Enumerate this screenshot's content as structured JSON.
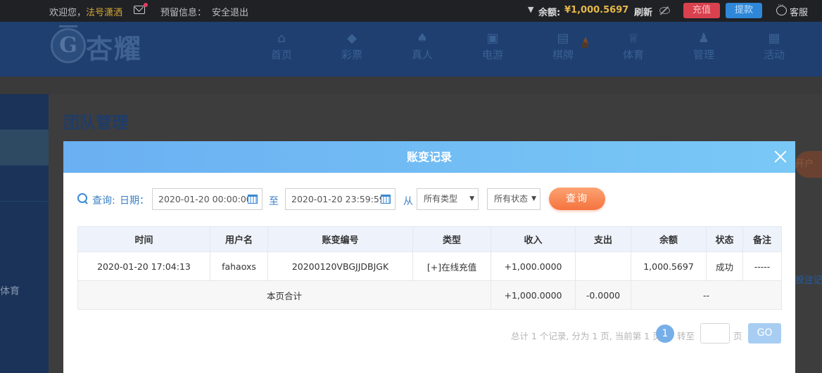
{
  "topbar": {
    "welcome": "欢迎您，",
    "username": "法号潇洒",
    "reserved_info_label": "预留信息：",
    "logout": "安全退出",
    "balance_label": "余额:",
    "balance_value": "¥1,000.5697",
    "refresh": "刷新",
    "recharge": "充值",
    "withdraw": "提款",
    "service": "客服"
  },
  "nav": {
    "logo_text": "杏耀",
    "logo_mark": "G",
    "items": [
      {
        "label": "首页",
        "icon": "home-icon",
        "glyph": "⌂"
      },
      {
        "label": "彩票",
        "icon": "lottery-icon",
        "glyph": "◆"
      },
      {
        "label": "真人",
        "icon": "live-dealer-icon",
        "glyph": "♠"
      },
      {
        "label": "电游",
        "icon": "slot-game-icon",
        "glyph": "▣"
      },
      {
        "label": "棋牌",
        "icon": "card-game-icon",
        "glyph": "▤"
      },
      {
        "label": "体育",
        "icon": "trophy-icon",
        "glyph": "♕"
      },
      {
        "label": "管理",
        "icon": "users-icon",
        "glyph": "♟"
      },
      {
        "label": "活动",
        "icon": "gift-icon",
        "glyph": "▦"
      }
    ]
  },
  "page": {
    "title": "团队管理",
    "sidebar_item_sport": "体育",
    "right_button_fragment": "开户",
    "right_link_fragment": "投注记"
  },
  "modal": {
    "title": "账变记录",
    "query_label": "查询:",
    "date_label": "日期：",
    "date_start": "2020-01-20 00:00:00",
    "to_label": "至",
    "date_end": "2020-01-20 23:59:59",
    "from_label": "从",
    "type_select": "所有类型",
    "status_select": "所有状态",
    "query_button": "查询",
    "columns": [
      "时间",
      "用户名",
      "账变编号",
      "类型",
      "收入",
      "支出",
      "余额",
      "状态",
      "备注"
    ],
    "rows": [
      {
        "time": "2020-01-20 17:04:13",
        "username": "fahaoxs",
        "serial": "20200120VBGJJDBJGK",
        "type": "[+]在线充值",
        "income": "+1,000.0000",
        "expense": "",
        "balance": "1,000.5697",
        "status": "成功",
        "note": "-----"
      }
    ],
    "summary": {
      "label": "本页合计",
      "income": "+1,000.0000",
      "expense": "-0.0000",
      "rest": "--"
    },
    "pager": {
      "info": "总计 1 个记录, 分为 1 页, 当前第 1 页",
      "current_page": "1",
      "goto_label": "转至",
      "page_suffix": "页",
      "go": "GO"
    }
  },
  "colors": {
    "topbar_bg": "#1f2125",
    "nav_bg": "#1f3f70",
    "modal_header": "#6ab0f2",
    "query_button": "#f5733e",
    "income_text": "#5fa630",
    "recharge_btn": "#d9414f",
    "withdraw_btn": "#2e87d7"
  }
}
